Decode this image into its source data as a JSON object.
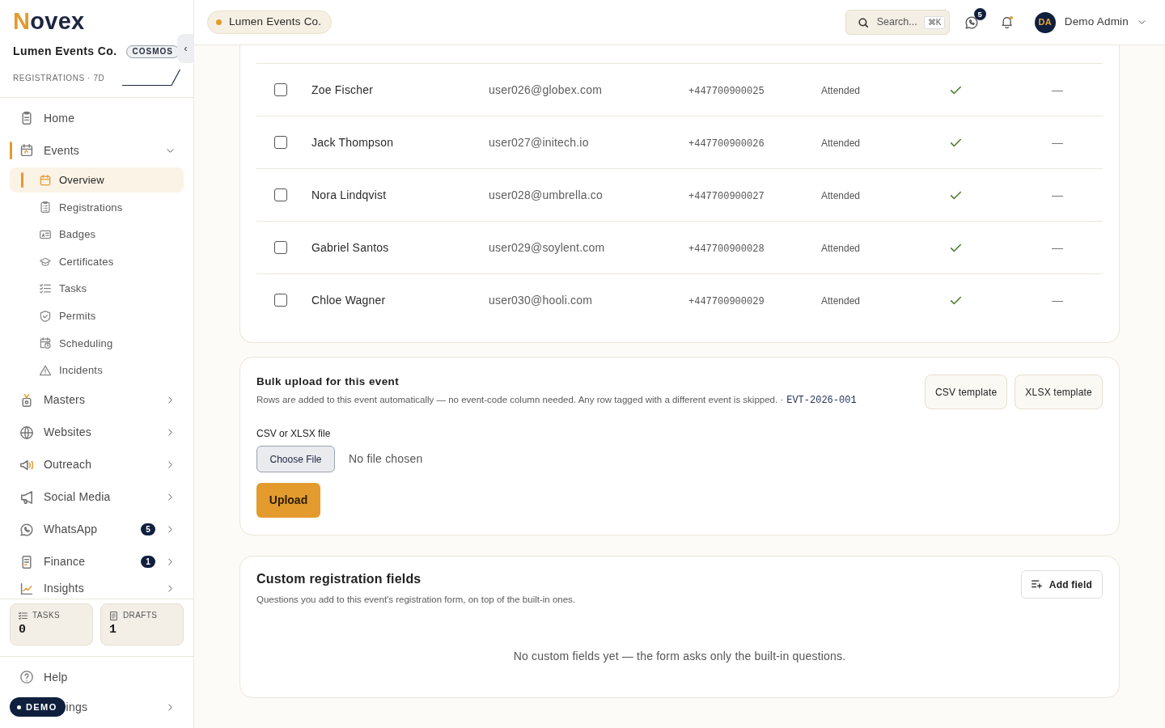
{
  "sidebar": {
    "logo": "Novex",
    "org_name": "Lumen Events Co.",
    "plan_badge": "COSMOS",
    "collapse_button": "‹",
    "metric_label": "REGISTRATIONS · 7D",
    "nav": [
      {
        "kind": "link",
        "label": "Home",
        "selected": false
      },
      {
        "kind": "group",
        "label": "Events",
        "selected": true,
        "expanded": true,
        "children": [
          {
            "label": "Overview",
            "selected": true
          },
          {
            "label": "Registrations",
            "selected": false
          },
          {
            "label": "Badges",
            "selected": false
          },
          {
            "label": "Certificates",
            "selected": false
          },
          {
            "label": "Tasks",
            "selected": false
          },
          {
            "label": "Permits",
            "selected": false
          },
          {
            "label": "Scheduling",
            "selected": false
          },
          {
            "label": "Incidents",
            "selected": false
          }
        ]
      },
      {
        "kind": "group",
        "label": "Masters",
        "selected": false,
        "expanded": false
      },
      {
        "kind": "group",
        "label": "Websites",
        "selected": false,
        "expanded": false
      },
      {
        "kind": "group",
        "label": "Outreach",
        "selected": false,
        "expanded": false
      },
      {
        "kind": "group",
        "label": "Social Media",
        "selected": false,
        "expanded": false
      },
      {
        "kind": "group",
        "label": "WhatsApp",
        "selected": false,
        "expanded": false,
        "badge": "5"
      },
      {
        "kind": "group",
        "label": "Finance",
        "selected": false,
        "expanded": false,
        "badge": "1"
      },
      {
        "kind": "group",
        "label": "Insights",
        "selected": false,
        "expanded": false
      }
    ],
    "stats": [
      {
        "label": "TASKS",
        "value": "0"
      },
      {
        "label": "DRAFTS",
        "value": "1"
      }
    ],
    "footer_nav": [
      {
        "kind": "link",
        "label": "Help",
        "selected": false
      },
      {
        "kind": "group",
        "label": "ings",
        "selected": false,
        "expanded": false
      }
    ],
    "demo_badge": "DEMO"
  },
  "topbar": {
    "org_pill": "Lumen Events Co.",
    "search": {
      "label": "Search...",
      "shortcut": "⌘K"
    },
    "whatsapp_count": "5",
    "notifications": {
      "unread": true
    },
    "user": {
      "initials": "DA",
      "name": "Demo Admin"
    }
  },
  "table": {
    "rows": [
      {
        "selected": false,
        "name": "Zoe Fischer",
        "email": "user026@globex.com",
        "phone": "+447700900025",
        "status": "Attended",
        "column_6": true,
        "column_7": "—"
      },
      {
        "selected": false,
        "name": "Jack Thompson",
        "email": "user027@initech.io",
        "phone": "+447700900026",
        "status": "Attended",
        "column_6": true,
        "column_7": "—"
      },
      {
        "selected": false,
        "name": "Nora Lindqvist",
        "email": "user028@umbrella.co",
        "phone": "+447700900027",
        "status": "Attended",
        "column_6": true,
        "column_7": "—"
      },
      {
        "selected": false,
        "name": "Gabriel Santos",
        "email": "user029@soylent.com",
        "phone": "+447700900028",
        "status": "Attended",
        "column_6": true,
        "column_7": "—"
      },
      {
        "selected": false,
        "name": "Chloe Wagner",
        "email": "user030@hooli.com",
        "phone": "+447700900029",
        "status": "Attended",
        "column_6": true,
        "column_7": "—"
      }
    ]
  },
  "bulk_upload": {
    "title": "Bulk upload for this event",
    "description": "Rows are added to this event automatically — no event-code column needed. Any row tagged with a different event is skipped. ·",
    "event_code": "EVT-2026-001",
    "template_buttons": [
      "CSV template",
      "XLSX template"
    ],
    "file_label": "CSV or XLSX file",
    "choose_button": "Choose File",
    "file_status": "No file chosen",
    "upload_button": "Upload"
  },
  "custom_fields": {
    "title": "Custom registration fields",
    "description": "Questions you add to this event's registration form, on top of the built-in ones.",
    "add_button": "Add field",
    "empty_message": "No custom fields yet — the form asks only the built-in questions."
  }
}
